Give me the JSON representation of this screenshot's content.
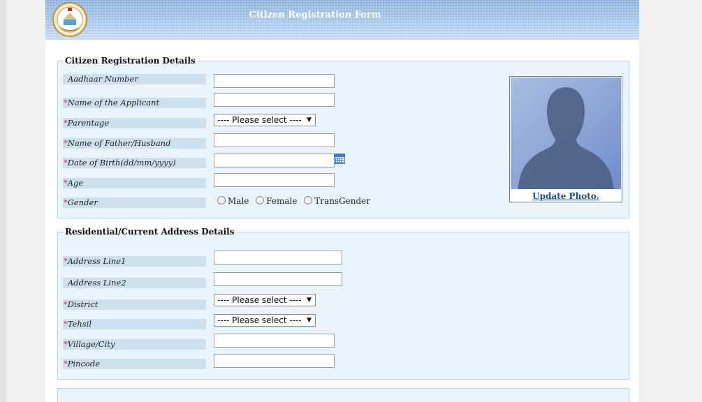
{
  "header": {
    "title": "Citizen Registration Form",
    "logo_icon": "government-emblem-icon"
  },
  "registration_details": {
    "legend": "Citizen Registration Details",
    "aadhaar_label": "Aadhaar Number",
    "applicant_label": "Name of the Applicant",
    "parentage_label": "Parentage",
    "parentage_selected": "---- Please select ----",
    "father_husband_label": "Name of Father/Husband",
    "dob_label": "Date of Birth(dd/mm/yyyy)",
    "age_label": "Age",
    "gender_label": "Gender",
    "gender_options": [
      "Male",
      "Female",
      "TransGender"
    ],
    "update_photo_label": "Update Photo.",
    "required_mark": "*"
  },
  "address_details": {
    "legend": "Residential/Current Address Details",
    "address1_label": "Address Line1",
    "address2_label": "Address Line2",
    "district_label": "District",
    "district_selected": "---- Please select ----",
    "tehsil_label": "Tehsil",
    "tehsil_selected": "---- Please select ----",
    "village_label": "Village/City",
    "pincode_label": "Pincode"
  },
  "colors": {
    "required": "#e03030",
    "label_bg": "#cde0ee",
    "fieldset_bg": "#eaf4fd",
    "link": "#1e4a8c"
  }
}
